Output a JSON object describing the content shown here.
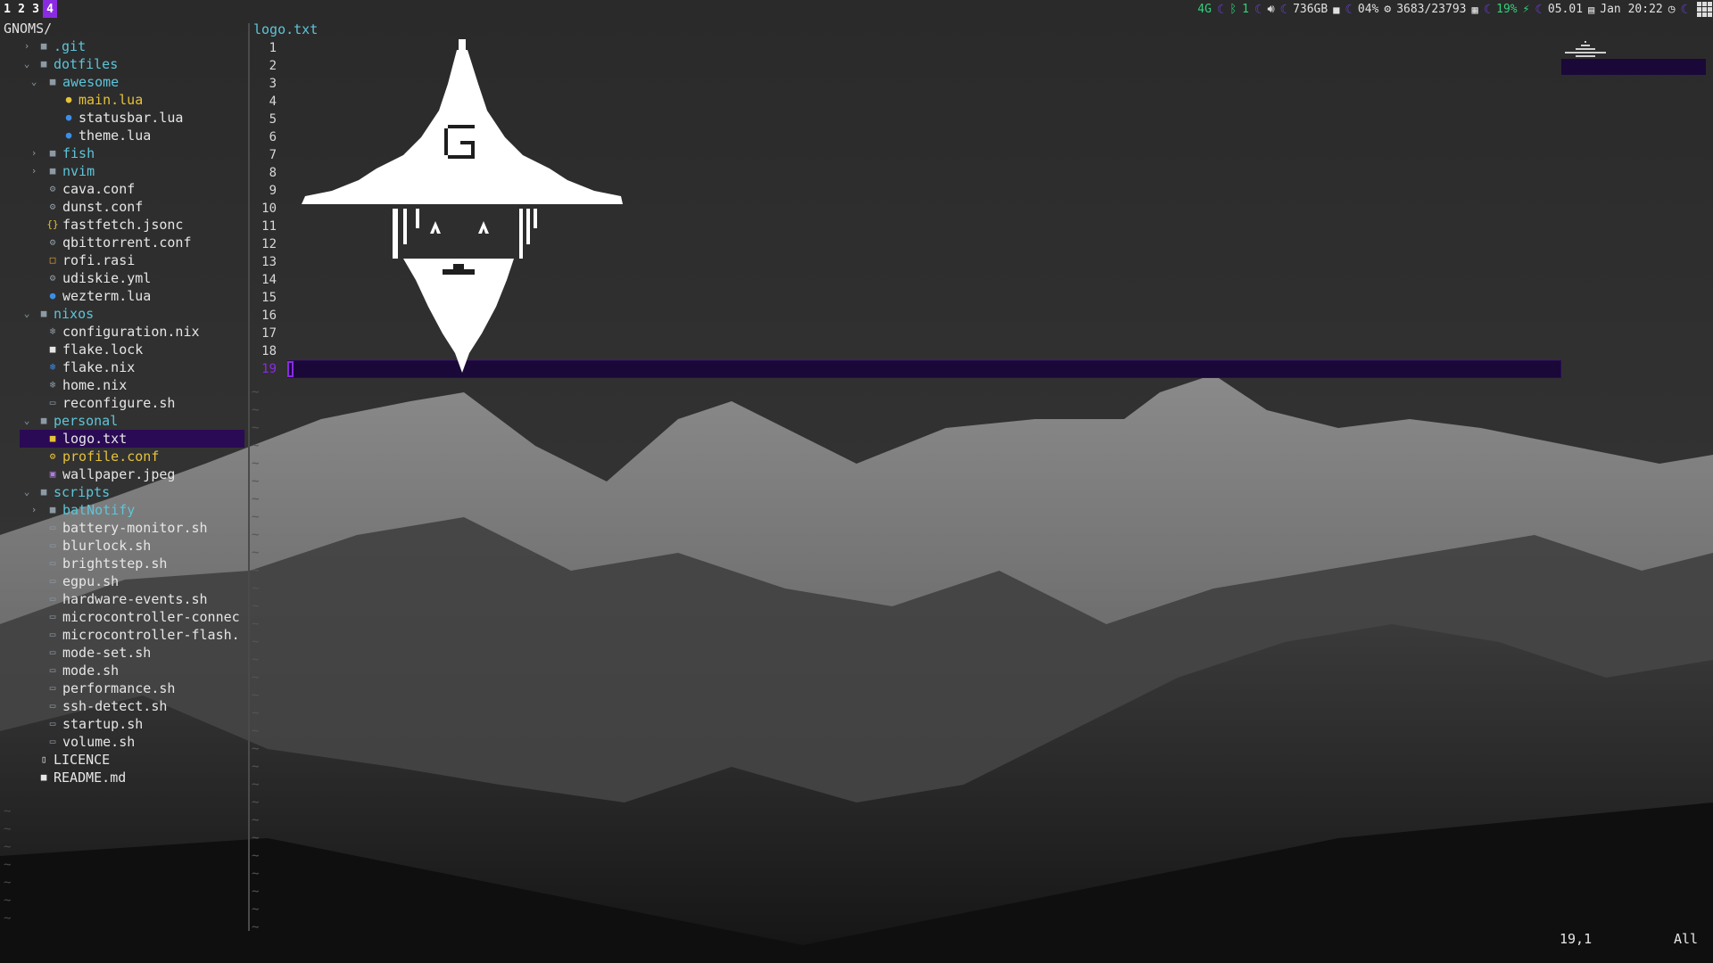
{
  "statusbar": {
    "tags": [
      "1",
      "2",
      "3",
      "4"
    ],
    "active_tag": "4",
    "network": "4G",
    "bluetooth_count": "1",
    "disk": "736GB",
    "cpu": "04%",
    "memory": "3683/23793",
    "battery": "19%",
    "time_left": "05.01",
    "datetime": "Jan 20:22",
    "colors": {
      "accent": "#8a2be2",
      "green": "#33d17a"
    }
  },
  "tree": {
    "root": "GNOMS/",
    "rows": [
      {
        "depth": 1,
        "chev": "›",
        "icon": "folder-icon",
        "glyph": "■",
        "kind": "dir",
        "label": ".git"
      },
      {
        "depth": 1,
        "chev": "⌄",
        "icon": "folder-open-icon",
        "glyph": "■",
        "kind": "dir",
        "label": "dotfiles"
      },
      {
        "depth": 2,
        "chev": "⌄",
        "icon": "folder-open-icon",
        "glyph": "■",
        "kind": "dir",
        "label": "awesome"
      },
      {
        "depth": 3,
        "chev": "",
        "icon": "lua-file-icon",
        "glyph": "●",
        "kind": "yellow",
        "iconcls": "yellow",
        "label": "main.lua"
      },
      {
        "depth": 3,
        "chev": "",
        "icon": "lua-file-icon",
        "glyph": "●",
        "kind": "file",
        "iconcls": "lua",
        "label": "statusbar.lua"
      },
      {
        "depth": 3,
        "chev": "",
        "icon": "lua-file-icon",
        "glyph": "●",
        "kind": "file",
        "iconcls": "lua",
        "label": "theme.lua"
      },
      {
        "depth": 2,
        "chev": "›",
        "icon": "folder-icon",
        "glyph": "■",
        "kind": "dir",
        "label": "fish"
      },
      {
        "depth": 2,
        "chev": "›",
        "icon": "folder-icon",
        "glyph": "■",
        "kind": "dir",
        "label": "nvim"
      },
      {
        "depth": 2,
        "chev": "",
        "icon": "gear-icon",
        "glyph": "⚙",
        "kind": "file",
        "iconcls": "gear",
        "label": "cava.conf"
      },
      {
        "depth": 2,
        "chev": "",
        "icon": "gear-icon",
        "glyph": "⚙",
        "kind": "file",
        "iconcls": "gear",
        "label": "dunst.conf"
      },
      {
        "depth": 2,
        "chev": "",
        "icon": "json-braces-icon",
        "glyph": "{}",
        "kind": "file",
        "iconcls": "yellow",
        "label": "fastfetch.jsonc"
      },
      {
        "depth": 2,
        "chev": "",
        "icon": "gear-icon",
        "glyph": "⚙",
        "kind": "file",
        "iconcls": "gear",
        "label": "qbittorrent.conf"
      },
      {
        "depth": 2,
        "chev": "",
        "icon": "square-icon",
        "glyph": "□",
        "kind": "file",
        "iconcls": "orange",
        "label": "rofi.rasi"
      },
      {
        "depth": 2,
        "chev": "",
        "icon": "gear-icon",
        "glyph": "⚙",
        "kind": "file",
        "iconcls": "gear",
        "label": "udiskie.yml"
      },
      {
        "depth": 2,
        "chev": "",
        "icon": "lua-file-icon",
        "glyph": "●",
        "kind": "file",
        "iconcls": "lua",
        "label": "wezterm.lua"
      },
      {
        "depth": 1,
        "chev": "⌄",
        "icon": "folder-open-icon",
        "glyph": "■",
        "kind": "dir",
        "label": "nixos"
      },
      {
        "depth": 2,
        "chev": "",
        "icon": "nix-snowflake-icon",
        "glyph": "❄",
        "kind": "file",
        "iconcls": "gear",
        "label": "configuration.nix"
      },
      {
        "depth": 2,
        "chev": "",
        "icon": "lock-icon",
        "glyph": "■",
        "kind": "file",
        "iconcls": "file",
        "label": "flake.lock"
      },
      {
        "depth": 2,
        "chev": "",
        "icon": "nix-snowflake-icon",
        "glyph": "❄",
        "kind": "file",
        "iconcls": "lua",
        "label": "flake.nix"
      },
      {
        "depth": 2,
        "chev": "",
        "icon": "nix-snowflake-icon",
        "glyph": "❄",
        "kind": "file",
        "iconcls": "gear",
        "label": "home.nix"
      },
      {
        "depth": 2,
        "chev": "",
        "icon": "shell-file-icon",
        "glyph": "▭",
        "kind": "file",
        "iconcls": "gear",
        "label": "reconfigure.sh"
      },
      {
        "depth": 1,
        "chev": "⌄",
        "icon": "folder-open-icon",
        "glyph": "■",
        "kind": "dir",
        "label": "personal"
      },
      {
        "depth": 2,
        "chev": "",
        "icon": "text-file-icon",
        "glyph": "■",
        "kind": "file",
        "iconcls": "yellow",
        "label": "logo.txt",
        "selected": true
      },
      {
        "depth": 2,
        "chev": "",
        "icon": "gear-icon",
        "glyph": "⚙",
        "kind": "yellow",
        "iconcls": "yellow",
        "label": "profile.conf"
      },
      {
        "depth": 2,
        "chev": "",
        "icon": "image-file-icon",
        "glyph": "▣",
        "kind": "file",
        "iconcls": "purple",
        "label": "wallpaper.jpeg"
      },
      {
        "depth": 1,
        "chev": "⌄",
        "icon": "folder-open-icon",
        "glyph": "■",
        "kind": "dir",
        "label": "scripts"
      },
      {
        "depth": 2,
        "chev": "›",
        "icon": "folder-icon",
        "glyph": "■",
        "kind": "dir",
        "label": "batNotify"
      },
      {
        "depth": 2,
        "chev": "",
        "icon": "shell-file-icon",
        "glyph": "▭",
        "kind": "file",
        "iconcls": "gear",
        "label": "battery-monitor.sh"
      },
      {
        "depth": 2,
        "chev": "",
        "icon": "shell-file-icon",
        "glyph": "▭",
        "kind": "file",
        "iconcls": "gear",
        "label": "blurlock.sh"
      },
      {
        "depth": 2,
        "chev": "",
        "icon": "shell-file-icon",
        "glyph": "▭",
        "kind": "file",
        "iconcls": "gear",
        "label": "brightstep.sh"
      },
      {
        "depth": 2,
        "chev": "",
        "icon": "shell-file-icon",
        "glyph": "▭",
        "kind": "file",
        "iconcls": "gear",
        "label": "egpu.sh"
      },
      {
        "depth": 2,
        "chev": "",
        "icon": "shell-file-icon",
        "glyph": "▭",
        "kind": "file",
        "iconcls": "gear",
        "label": "hardware-events.sh"
      },
      {
        "depth": 2,
        "chev": "",
        "icon": "shell-file-icon",
        "glyph": "▭",
        "kind": "file",
        "iconcls": "gear",
        "label": "microcontroller-connec"
      },
      {
        "depth": 2,
        "chev": "",
        "icon": "shell-file-icon",
        "glyph": "▭",
        "kind": "file",
        "iconcls": "gear",
        "label": "microcontroller-flash."
      },
      {
        "depth": 2,
        "chev": "",
        "icon": "shell-file-icon",
        "glyph": "▭",
        "kind": "file",
        "iconcls": "gear",
        "label": "mode-set.sh"
      },
      {
        "depth": 2,
        "chev": "",
        "icon": "shell-file-icon",
        "glyph": "▭",
        "kind": "file",
        "iconcls": "gear",
        "label": "mode.sh"
      },
      {
        "depth": 2,
        "chev": "",
        "icon": "shell-file-icon",
        "glyph": "▭",
        "kind": "file",
        "iconcls": "gear",
        "label": "performance.sh"
      },
      {
        "depth": 2,
        "chev": "",
        "icon": "shell-file-icon",
        "glyph": "▭",
        "kind": "file",
        "iconcls": "gear",
        "label": "ssh-detect.sh"
      },
      {
        "depth": 2,
        "chev": "",
        "icon": "shell-file-icon",
        "glyph": "▭",
        "kind": "file",
        "iconcls": "gear",
        "label": "startup.sh"
      },
      {
        "depth": 2,
        "chev": "",
        "icon": "shell-file-icon",
        "glyph": "▭",
        "kind": "file",
        "iconcls": "gear",
        "label": "volume.sh"
      },
      {
        "depth": 1,
        "chev": "",
        "icon": "license-file-icon",
        "glyph": "▯",
        "kind": "file",
        "iconcls": "file",
        "label": "LICENCE"
      },
      {
        "depth": 1,
        "chev": "",
        "icon": "markdown-file-icon",
        "glyph": "■",
        "kind": "file",
        "iconcls": "file",
        "label": "README.md"
      }
    ]
  },
  "editor": {
    "filename": "logo.txt",
    "line_count": 19,
    "current_line": 19,
    "cursor_position": "19,1",
    "scroll_position": "All"
  }
}
